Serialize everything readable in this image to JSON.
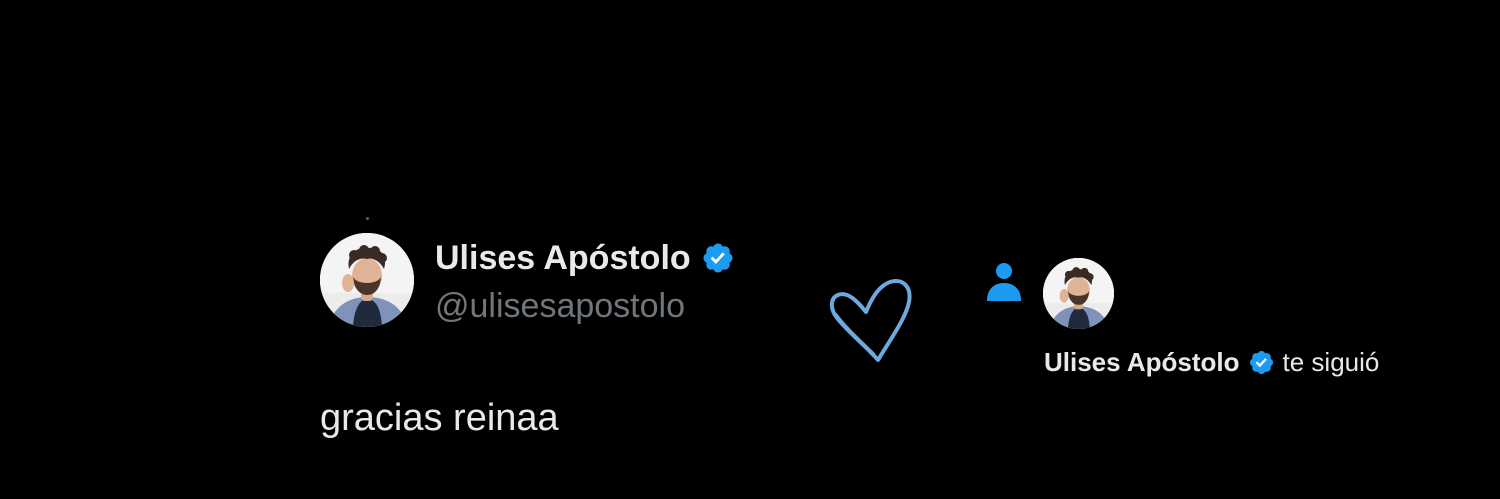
{
  "colors": {
    "background": "#000000",
    "primary_text": "#e7e9ea",
    "secondary_text": "#71767b",
    "verified_blue": "#1d9bf0",
    "heart_outline": "#6fa8dc"
  },
  "tweet": {
    "display_name": "Ulises Apóstolo",
    "handle": "@ulisesapostolo",
    "text": "gracias reinaa",
    "verified": true,
    "avatar_icon": "profile-photo"
  },
  "decorations": {
    "heart_icon": "heart-outline-icon"
  },
  "notification": {
    "type_icon": "person-icon",
    "display_name": "Ulises Apóstolo",
    "verified": true,
    "action_text": "te siguió",
    "avatar_icon": "profile-photo"
  }
}
